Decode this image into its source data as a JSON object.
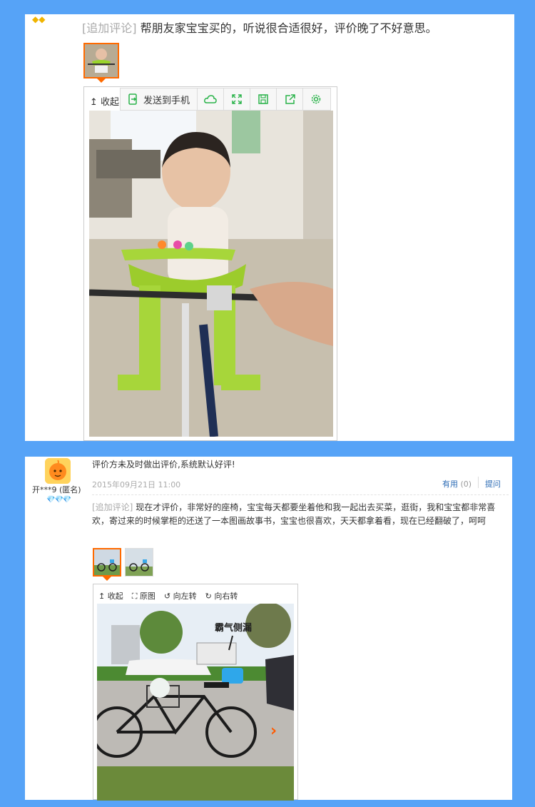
{
  "colors": {
    "background": "#56a3f7",
    "accent": "#ff6a00",
    "link": "#2b6bb5",
    "toolbar_green": "#2ab34a"
  },
  "review1": {
    "badge_glyph": "◆◆",
    "append_tag": "[追加评论]",
    "append_text": "帮朋友家宝宝买的，听说很合适很好，评价晚了不好意思。",
    "viewer": {
      "collapse_label": "收起",
      "send_to_phone_label": "发送到手机",
      "icons": [
        "cloud-icon",
        "expand-icon",
        "save-icon",
        "share-icon",
        "settings-icon"
      ]
    }
  },
  "review2": {
    "username": "开***9",
    "anonymous_label": "(匿名)",
    "level_glyph": "💎💎💎",
    "initial_text": "评价方未及时做出评价,系统默认好评!",
    "date": "2015年09月21日 11:00",
    "useful_label": "有用",
    "useful_count": "(0)",
    "ask_label": "提问",
    "append_tag": "[追加评论]",
    "append_text": "现在才评价，非常好的座椅，宝宝每天都要坐着他和我一起出去买菜，逛街，我和宝宝都非常喜欢，寄过来的时候掌柜的还送了一本图画故事书，宝宝也很喜欢，天天都拿着看，现在已经翻破了，呵呵",
    "viewer": {
      "collapse_label": "收起",
      "original_label": "原图",
      "rotate_left_label": "向左转",
      "rotate_right_label": "向右转",
      "next_glyph": "›"
    },
    "photo_caption": "霸气侧漏"
  }
}
